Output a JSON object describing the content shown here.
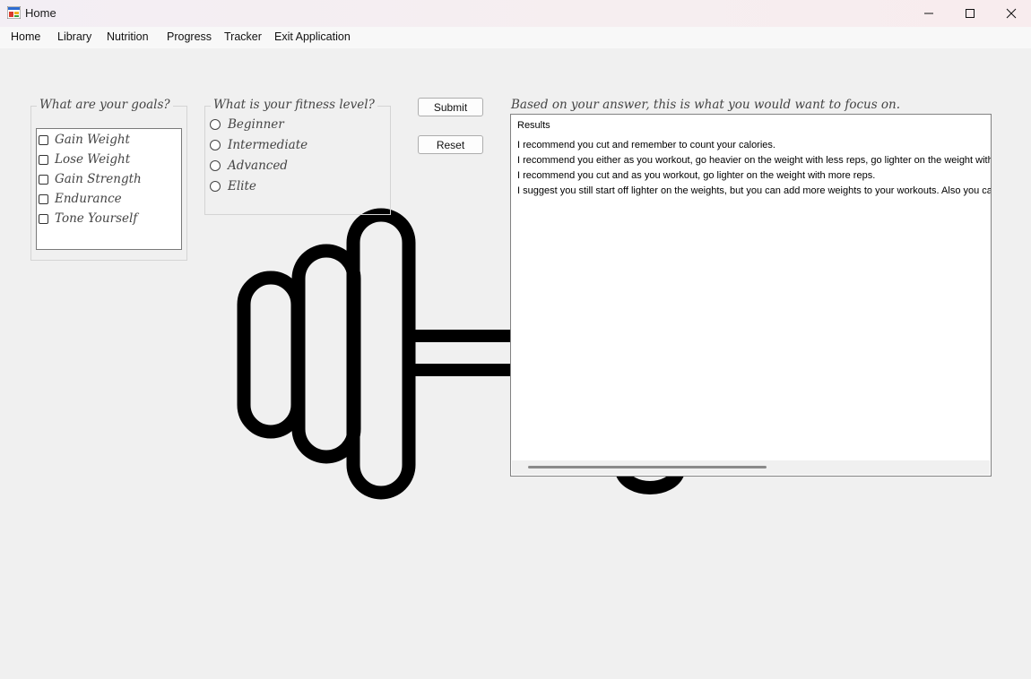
{
  "window": {
    "title": "Home",
    "minimize_glyph": "—",
    "maximize_glyph": "☐",
    "close_glyph": "✕"
  },
  "menu": {
    "items": [
      "Home",
      "Library",
      "Nutrition",
      "Progress",
      "Tracker",
      "Exit Application"
    ]
  },
  "goals": {
    "legend": "What are your goals?",
    "options": [
      "Gain Weight",
      "Lose Weight",
      "Gain Strength",
      "Endurance",
      "Tone Yourself"
    ]
  },
  "fitness": {
    "legend": "What is your fitness level?",
    "options": [
      "Beginner",
      "Intermediate",
      "Advanced",
      "Elite"
    ]
  },
  "buttons": {
    "submit": "Submit",
    "reset": "Reset"
  },
  "results": {
    "label": "Based on your answer, this is what you would want to focus on.",
    "lines": [
      "Results",
      "I recommend you cut and remember to count your calories.",
      "I recommend you either as you workout, go heavier on the weight with less reps, go lighter on the weight with more reps.",
      "I recommend you cut and as you workout, go lighter on the weight with more reps.",
      "I suggest you still start off lighter on the weights, but you can add more weights to your workouts. Also you can start adding some cardio."
    ]
  },
  "icons": {
    "app": "app-icon",
    "background": "dumbbell-icon"
  }
}
